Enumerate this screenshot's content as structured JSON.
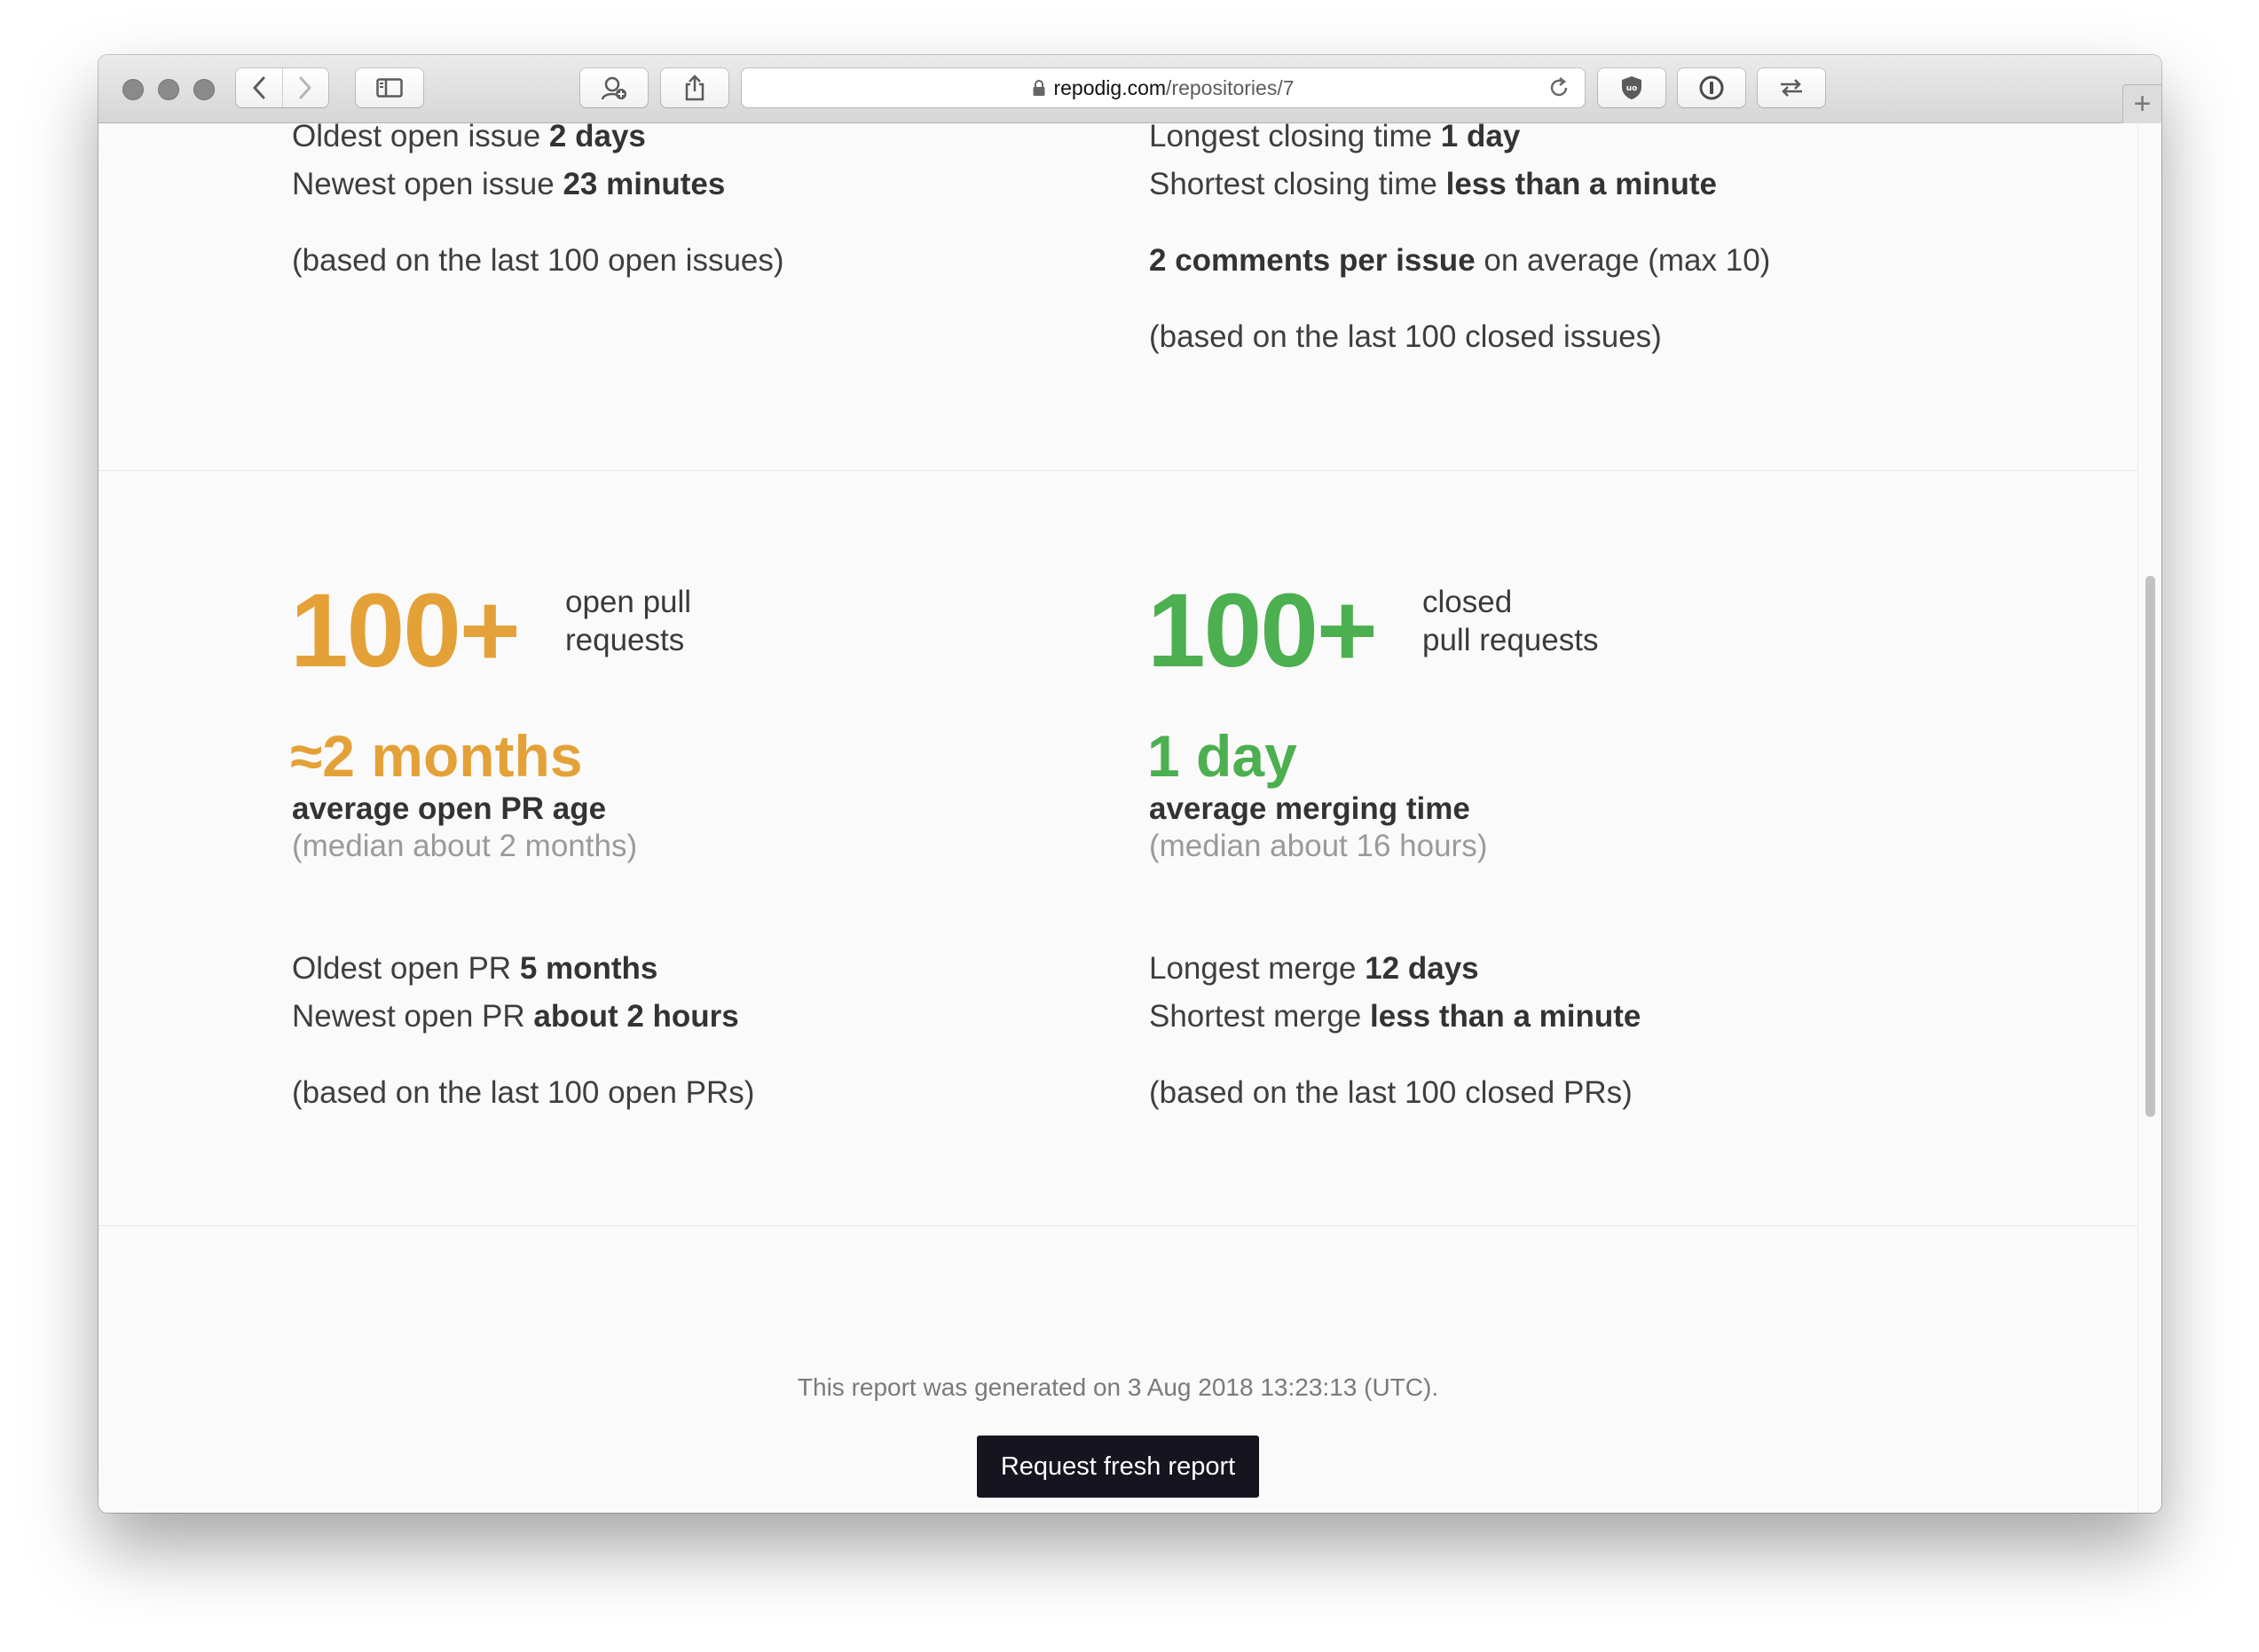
{
  "browser": {
    "url_host": "repodig.com",
    "url_path": "/repositories/7",
    "icons": [
      "back-icon",
      "forward-icon",
      "sidebar-icon",
      "profile-icon",
      "share-icon",
      "reload-icon",
      "ublock-icon",
      "onepassword-icon",
      "switch-icon",
      "new-tab-icon"
    ]
  },
  "issues": {
    "open": {
      "oldest_label": "Oldest open issue ",
      "oldest_value": "2 days",
      "newest_label": "Newest open issue ",
      "newest_value": "23 minutes",
      "basis": "(based on the last 100 open issues)"
    },
    "closed": {
      "longest_label": "Longest closing time ",
      "longest_value": "1 day",
      "shortest_label": "Shortest closing time ",
      "shortest_value": "less than a minute",
      "comments_value": "2 comments per issue",
      "comments_rest": " on average (max 10)",
      "basis": "(based on the last 100 closed issues)"
    }
  },
  "pull_requests": {
    "open": {
      "count": "100+",
      "count_label_1": "open pull",
      "count_label_2": "requests",
      "avg_value": "≈2 months",
      "avg_label": "average open PR age",
      "median": "(median about 2 months)",
      "oldest_label": "Oldest open PR ",
      "oldest_value": "5 months",
      "newest_label": "Newest open PR ",
      "newest_value": "about 2 hours",
      "basis": "(based on the last 100 open PRs)"
    },
    "closed": {
      "count": "100+",
      "count_label_1": "closed",
      "count_label_2": "pull requests",
      "avg_value": "1 day",
      "avg_label": "average merging time",
      "median": "(median about 16 hours)",
      "longest_label": "Longest merge ",
      "longest_value": "12 days",
      "shortest_label": "Shortest merge ",
      "shortest_value": "less than a minute",
      "basis": "(based on the last 100 closed PRs)"
    }
  },
  "footer": {
    "generated": "This report was generated on 3 Aug 2018 13:23:13 (UTC).",
    "button_label": "Request fresh report"
  },
  "colors": {
    "open_accent": "#e4a138",
    "closed_accent": "#4caf50",
    "button_bg": "#16141e"
  }
}
